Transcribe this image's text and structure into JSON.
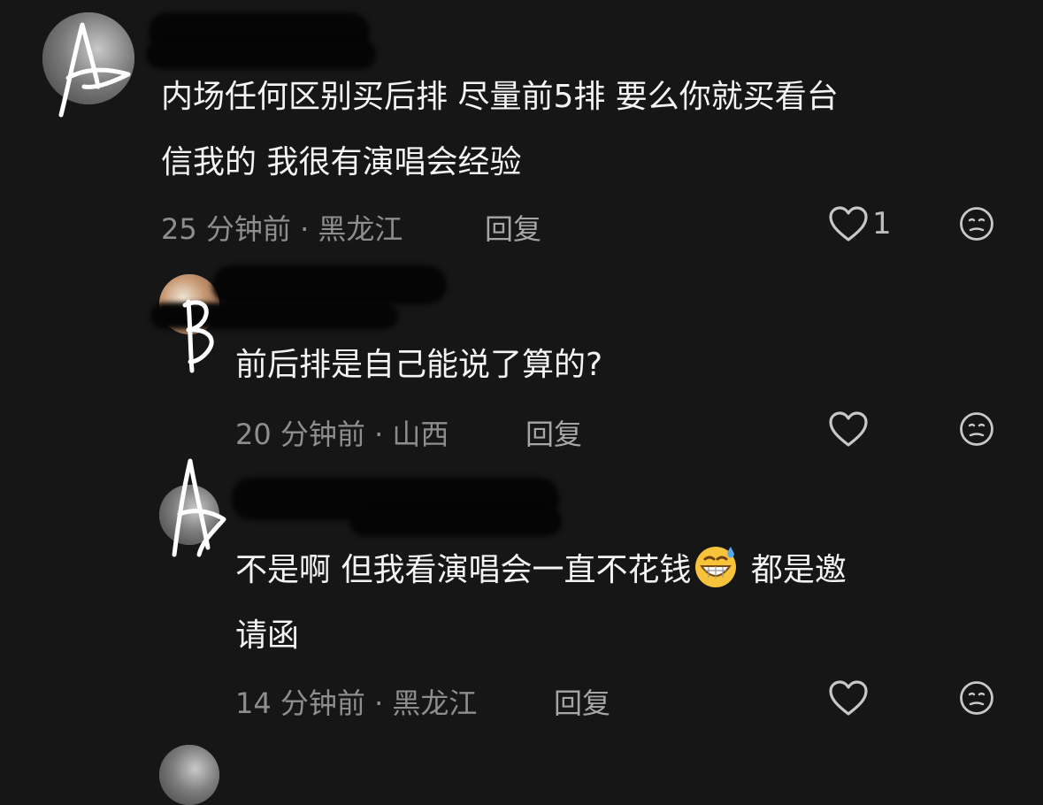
{
  "comments": [
    {
      "text_line1": "内场任何区别买后排 尽量前5排 要么你就买看台",
      "text_line2": "信我的 我很有演唱会经验",
      "meta": "25 分钟前 · 黑龙江",
      "reply_label": "回复",
      "like_count": "1"
    },
    {
      "text_line1": "前后排是自己能说了算的?",
      "meta": "20 分钟前 · 山西",
      "reply_label": "回复",
      "like_count": ""
    },
    {
      "text_before_emoji": "不是啊 但我看演唱会一直不花钱",
      "emoji": "grinning-sweat-emoji",
      "text_after_emoji": " 都是邀",
      "text_line2": "请函",
      "meta": "14 分钟前 · 黑龙江",
      "reply_label": "回复",
      "like_count": ""
    }
  ],
  "annotations": {
    "letter_a1": "A",
    "letter_b": "B",
    "letter_a2": "A"
  },
  "colors": {
    "background": "#161616",
    "text": "#f4f4f4",
    "meta": "#8e8e8e",
    "icon": "#c8c8c8"
  }
}
